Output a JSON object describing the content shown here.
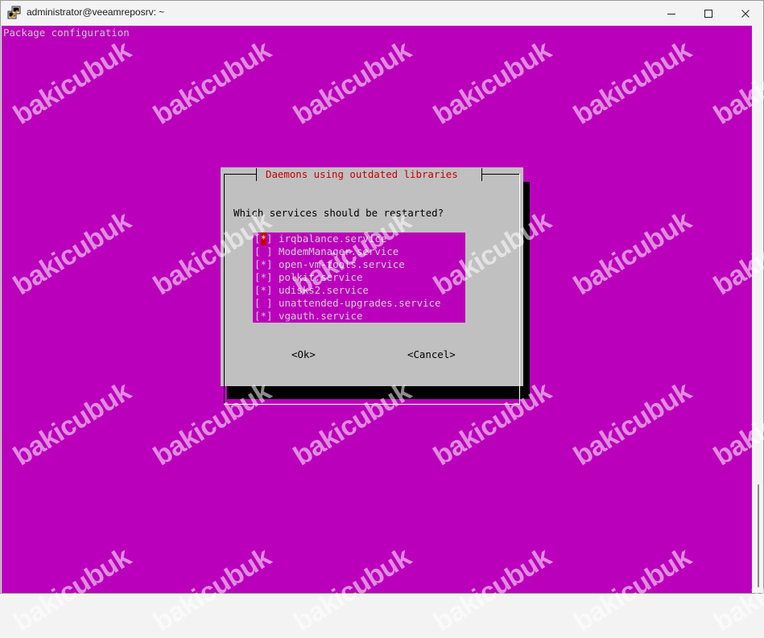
{
  "window": {
    "title": "administrator@veeamreposrv: ~"
  },
  "terminal": {
    "header": "Package configuration"
  },
  "dialog": {
    "title": "Daemons using outdated libraries",
    "question": "Which services should be restarted?",
    "services": [
      {
        "name": "irqbalance.service",
        "checked": true,
        "focused": true
      },
      {
        "name": "ModemManager.service",
        "checked": false,
        "focused": false
      },
      {
        "name": "open-vm-tools.service",
        "checked": true,
        "focused": false
      },
      {
        "name": "polkit.service",
        "checked": true,
        "focused": false
      },
      {
        "name": "udisks2.service",
        "checked": true,
        "focused": false
      },
      {
        "name": "unattended-upgrades.service",
        "checked": false,
        "focused": false
      },
      {
        "name": "vgauth.service",
        "checked": true,
        "focused": false
      }
    ],
    "ok_label": "<Ok>",
    "cancel_label": "<Cancel>"
  },
  "checkbox": {
    "left": "[",
    "right": "]",
    "checked_mark": "*",
    "unchecked_mark": " "
  },
  "watermark": {
    "text": "bakicubuk"
  },
  "colors": {
    "terminal_bg": "#bb00bb",
    "dialog_bg": "#c0c0c0",
    "dialog_title": "#c40000",
    "focus": "#c40000"
  }
}
